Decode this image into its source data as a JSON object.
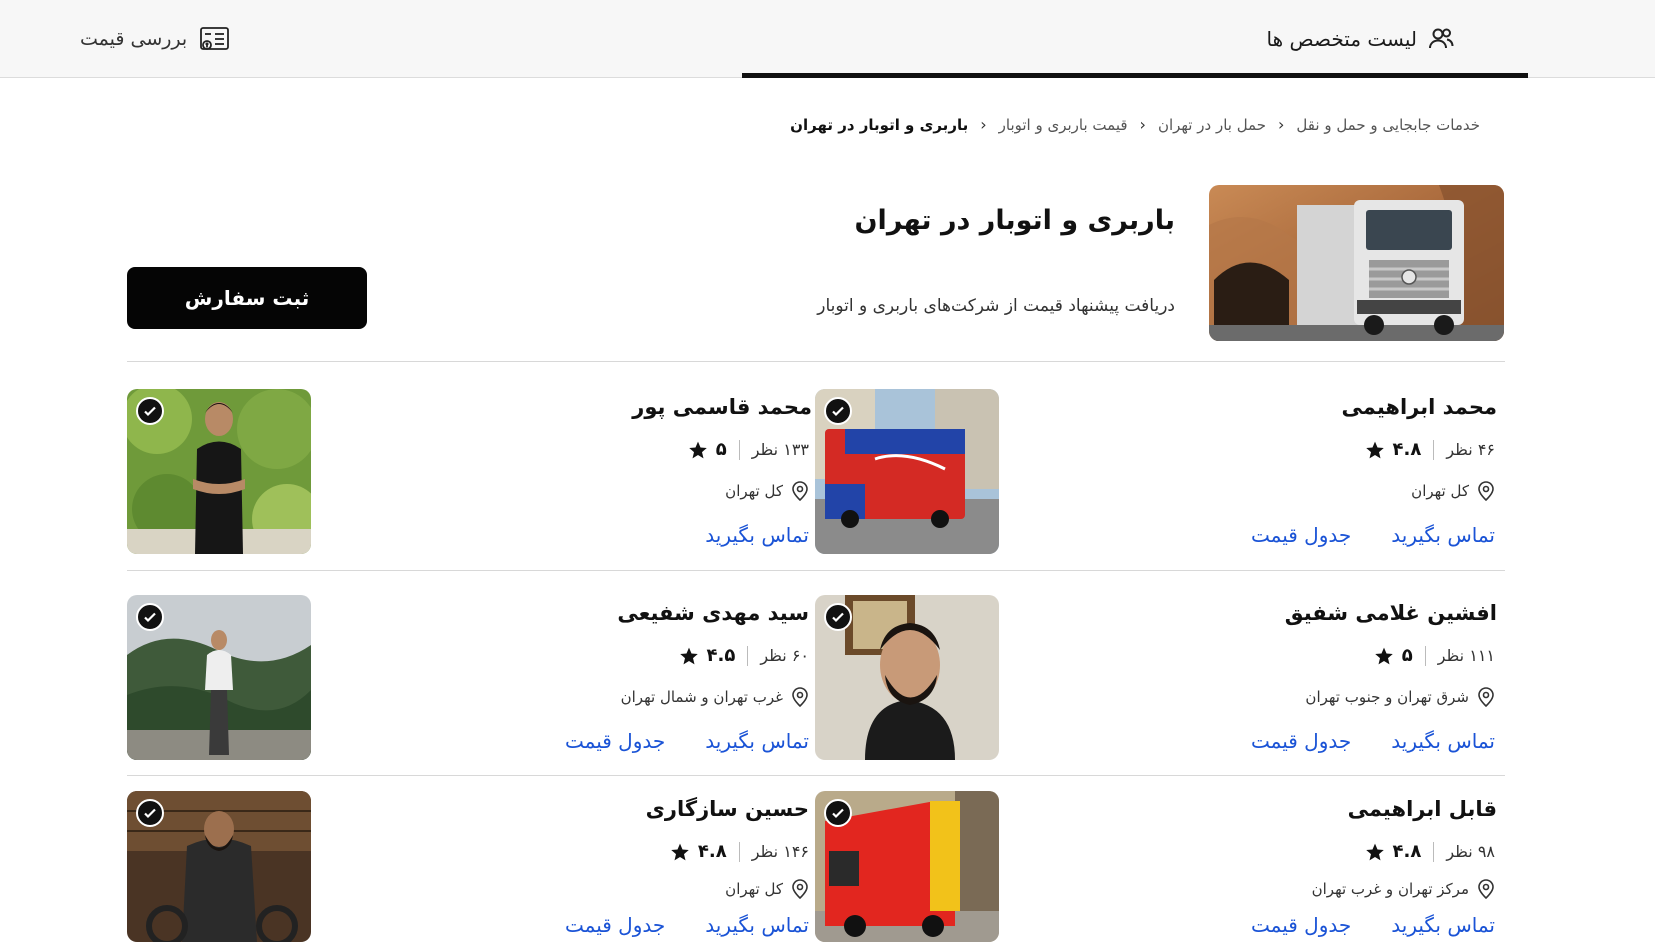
{
  "topbar": {
    "experts_tab": "لیست متخصص ها",
    "price_tab": "بررسی قیمت"
  },
  "breadcrumb": [
    "خدمات جابجایی و حمل و نقل",
    "حمل بار در تهران",
    "قیمت باربری و اتوبار",
    "باربری و اتوبار در تهران"
  ],
  "header": {
    "title": "باربری و اتوبار در تهران",
    "subtitle": "دریافت پیشنهاد قیمت از شرکت‌های باربری و اتوبار",
    "order_button": "ثبت سفارش"
  },
  "cards": [
    {
      "name": "محمد ابراهیمی",
      "reviews": "۴۶ نظر",
      "rating": "۴.۸",
      "location": "کل تهران",
      "contact": "تماس بگیرید",
      "price_table": "جدول قیمت",
      "photo": "blue-red-truck"
    },
    {
      "name": "محمد قاسمی پور",
      "reviews": "۱۳۳ نظر",
      "rating": "۵",
      "location": "کل تهران",
      "contact": "تماس بگیرید",
      "price_table": "",
      "photo": "man-in-trees"
    },
    {
      "name": "افشین غلامی شفیق",
      "reviews": "۱۱۱ نظر",
      "rating": "۵",
      "location": "شرق تهران و جنوب تهران",
      "contact": "تماس بگیرید",
      "price_table": "جدول قیمت",
      "photo": "bearded-man"
    },
    {
      "name": "سید مهدی شفیعی",
      "reviews": "۶۰ نظر",
      "rating": "۴.۵",
      "location": "غرب تهران و شمال تهران",
      "contact": "تماس بگیرید",
      "price_table": "جدول قیمت",
      "photo": "man-in-mountains"
    },
    {
      "name": "قابل ابراهیمی",
      "reviews": "۹۸ نظر",
      "rating": "۴.۸",
      "location": "مرکز تهران و غرب تهران",
      "contact": "تماس بگیرید",
      "price_table": "جدول قیمت",
      "photo": "red-truck"
    },
    {
      "name": "حسین سازگاری",
      "reviews": "۱۴۶ نظر",
      "rating": "۴.۸",
      "location": "کل تهران",
      "contact": "تماس بگیرید",
      "price_table": "جدول قیمت",
      "photo": "man-on-motorcycle"
    }
  ],
  "colors": {
    "link": "#1a53d6",
    "button_bg": "#050505",
    "topbar_bg": "#f7f7f7"
  }
}
